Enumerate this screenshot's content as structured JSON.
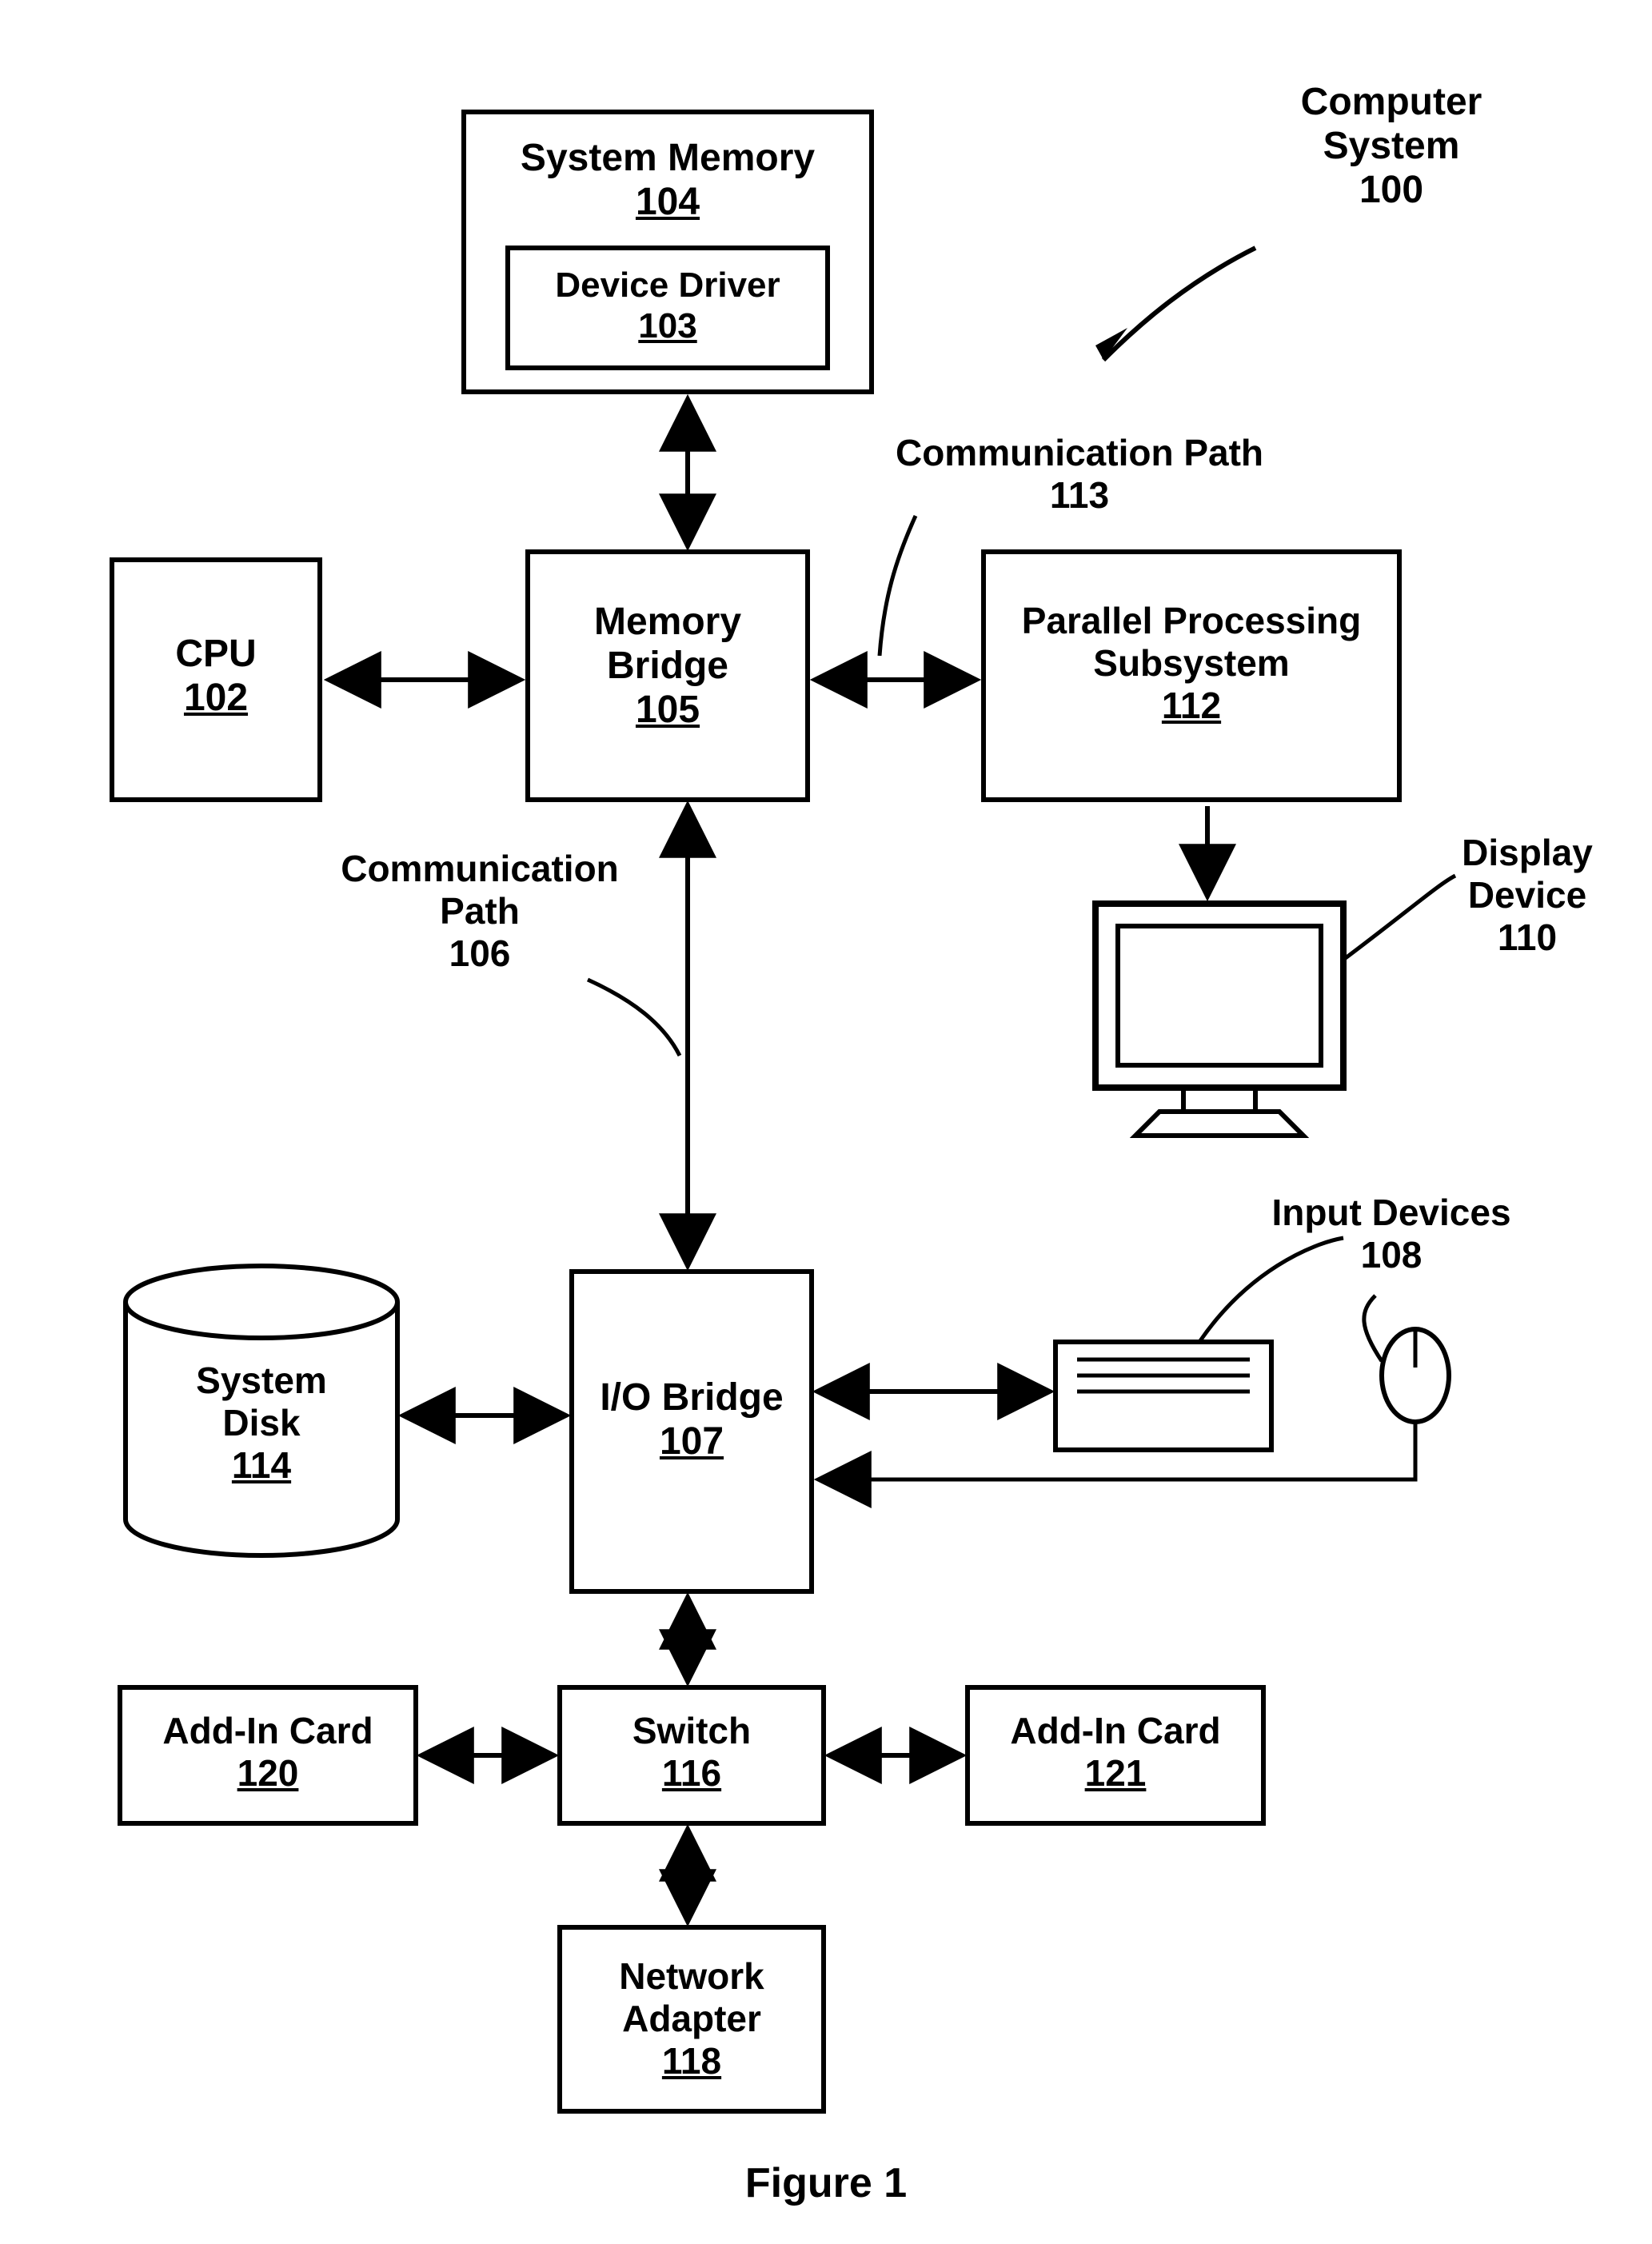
{
  "title": {
    "line1": "Computer",
    "line2": "System",
    "num": "100"
  },
  "blocks": {
    "system_memory": {
      "label": "System Memory",
      "num": "104"
    },
    "device_driver": {
      "label": "Device Driver",
      "num": "103"
    },
    "cpu": {
      "label": "CPU",
      "num": "102"
    },
    "memory_bridge": {
      "label": "Memory",
      "label2": "Bridge",
      "num": "105"
    },
    "pps": {
      "label": "Parallel Processing",
      "label2": "Subsystem",
      "num": "112"
    },
    "io_bridge": {
      "label": "I/O Bridge",
      "num": "107"
    },
    "system_disk": {
      "label": "System",
      "label2": "Disk",
      "num": "114"
    },
    "switch": {
      "label": "Switch",
      "num": "116"
    },
    "addin_left": {
      "label": "Add-In Card",
      "num": "120"
    },
    "addin_right": {
      "label": "Add-In Card",
      "num": "121"
    },
    "network_adapter": {
      "label": "Network",
      "label2": "Adapter",
      "num": "118"
    }
  },
  "labels": {
    "comm_path_113": {
      "label": "Communication Path",
      "num": "113"
    },
    "comm_path_106": {
      "label": "Communication",
      "label2": "Path",
      "num": "106"
    },
    "display_device": {
      "label": "Display",
      "label2": "Device",
      "num": "110"
    },
    "input_devices": {
      "label": "Input Devices",
      "num": "108"
    }
  },
  "figure_caption": "Figure 1"
}
